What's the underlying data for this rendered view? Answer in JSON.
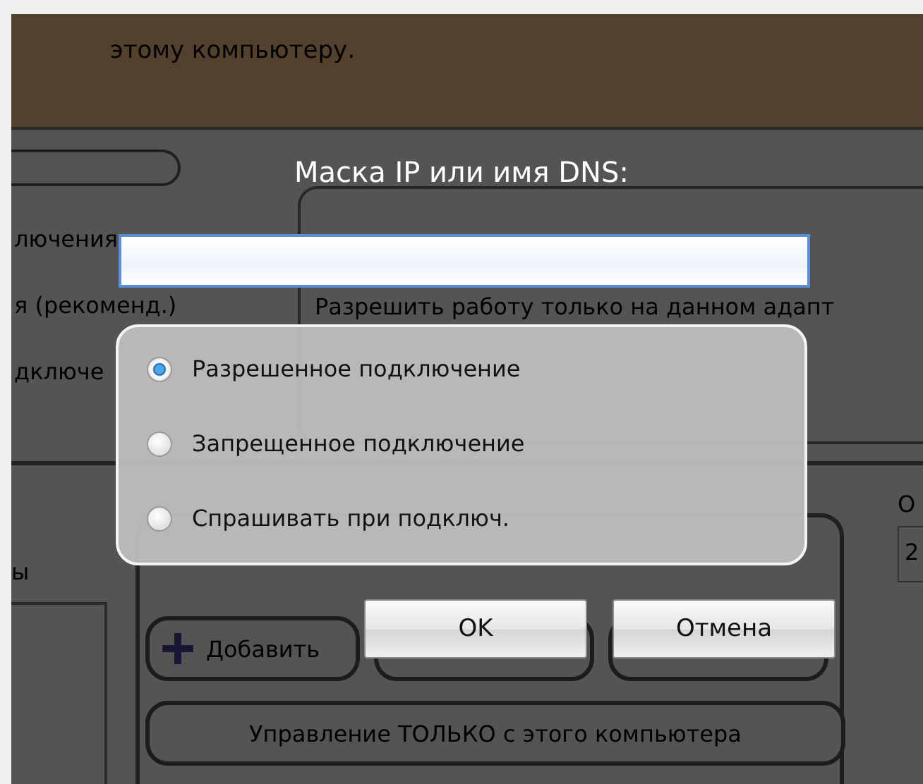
{
  "background": {
    "header_text": "этому компьютеру.",
    "left_labels": [
      "лючения",
      "я (рекоменд.)",
      "дключе"
    ],
    "adapter_hint": "Разрешить работу только на данном адапт",
    "list_label": "ы",
    "add_button": "Добавить",
    "control_button": "Управление ТОЛЬКО с этого компьютера",
    "side_label": "О",
    "side_value": "2"
  },
  "dialog": {
    "title": "Маска IP или имя DNS:",
    "options": [
      {
        "label": "Разрешенное подключение",
        "selected": true
      },
      {
        "label": "Запрещенное подключение",
        "selected": false
      },
      {
        "label": "Спрашивать при подключ.",
        "selected": false
      }
    ],
    "buttons": [
      "OK",
      "Отмена"
    ]
  }
}
